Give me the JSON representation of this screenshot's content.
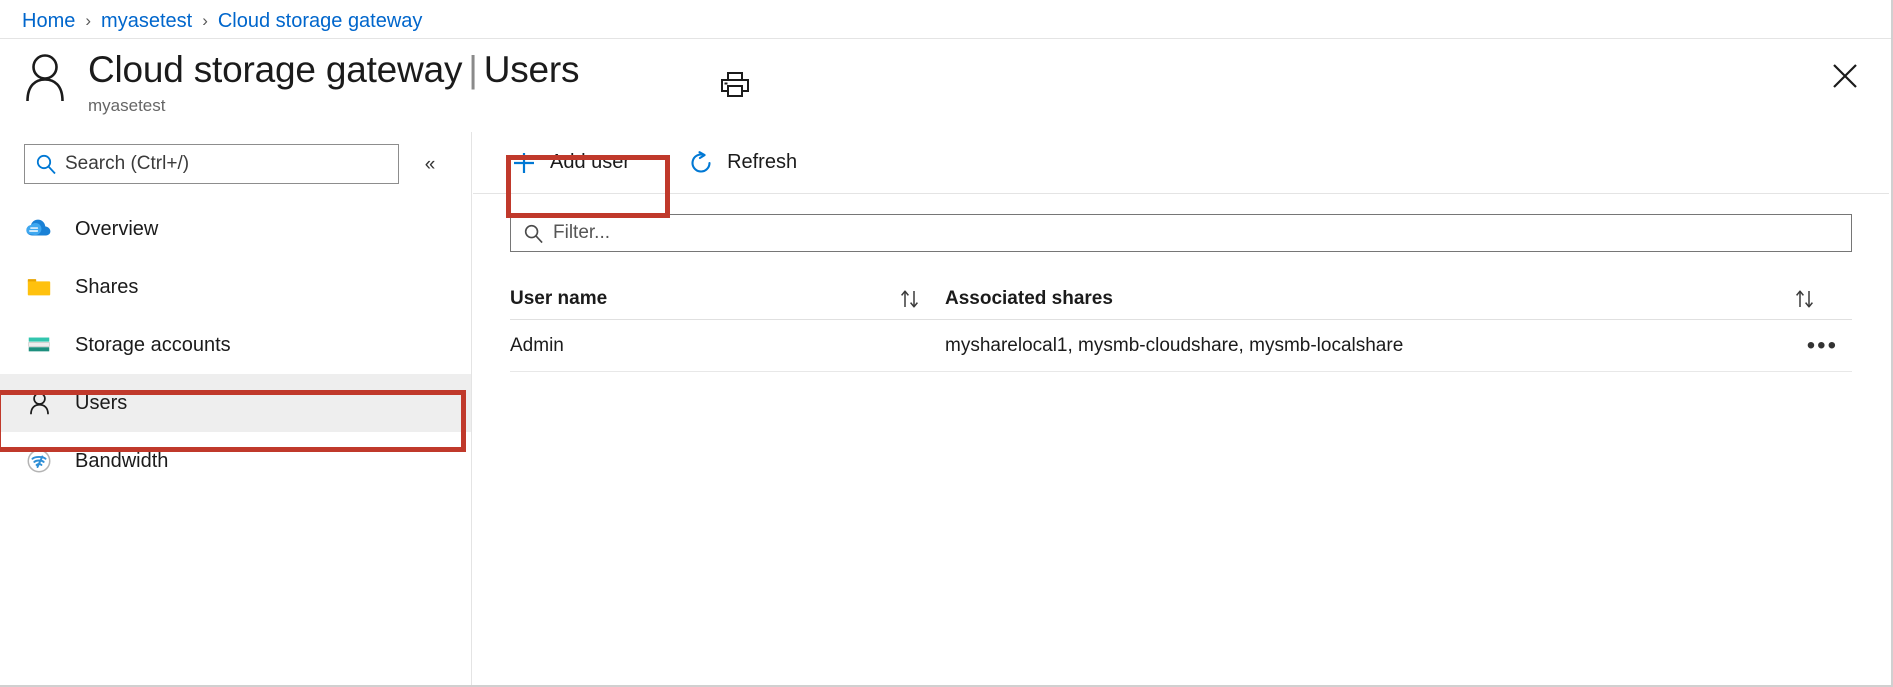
{
  "breadcrumb": {
    "items": [
      {
        "label": "Home"
      },
      {
        "label": "myasetest"
      },
      {
        "label": "Cloud storage gateway"
      }
    ],
    "separator": "›"
  },
  "header": {
    "title": "Cloud storage gateway",
    "title_separator": "|",
    "page": "Users",
    "subtitle": "myasetest",
    "avatar_icon": "person-icon",
    "print_icon": "print-icon",
    "close_icon": "close-icon"
  },
  "sidebar": {
    "search": {
      "placeholder": "Search (Ctrl+/)",
      "icon": "search-icon"
    },
    "collapse": {
      "icon": "chevron-double-left-icon",
      "glyph": "«"
    },
    "items": [
      {
        "label": "Overview",
        "icon": "cloud-icon",
        "selected": false
      },
      {
        "label": "Shares",
        "icon": "folder-icon",
        "selected": false
      },
      {
        "label": "Storage accounts",
        "icon": "storage-account-icon",
        "selected": false
      },
      {
        "label": "Users",
        "icon": "person-icon",
        "selected": true
      },
      {
        "label": "Bandwidth",
        "icon": "bandwidth-wifi-icon",
        "selected": false
      }
    ]
  },
  "toolbar": {
    "add_user_label": "Add user",
    "add_user_icon": "plus-icon",
    "refresh_label": "Refresh",
    "refresh_icon": "refresh-icon"
  },
  "filter": {
    "placeholder": "Filter...",
    "icon": "search-icon"
  },
  "table": {
    "columns": [
      {
        "header": "User name",
        "sort_icon": "sort-updown-icon"
      },
      {
        "header": "Associated shares",
        "sort_icon": "sort-updown-icon"
      }
    ],
    "rows": [
      {
        "user_name": "Admin",
        "associated_shares": "mysharelocal1, mysmb-cloudshare, mysmb-localshare",
        "more_icon": "ellipsis-icon",
        "more_glyph": "•••"
      }
    ]
  },
  "annotations": {
    "color": "#c0392b",
    "boxes": [
      {
        "name": "add-user-highlight"
      },
      {
        "name": "users-nav-highlight"
      }
    ]
  },
  "colors": {
    "link": "#0066cc",
    "accent_blue": "#0078d4",
    "selected_bg": "#eeeeee",
    "folder_yellow": "#ffb900",
    "storage_teal": "#30c9b0"
  }
}
